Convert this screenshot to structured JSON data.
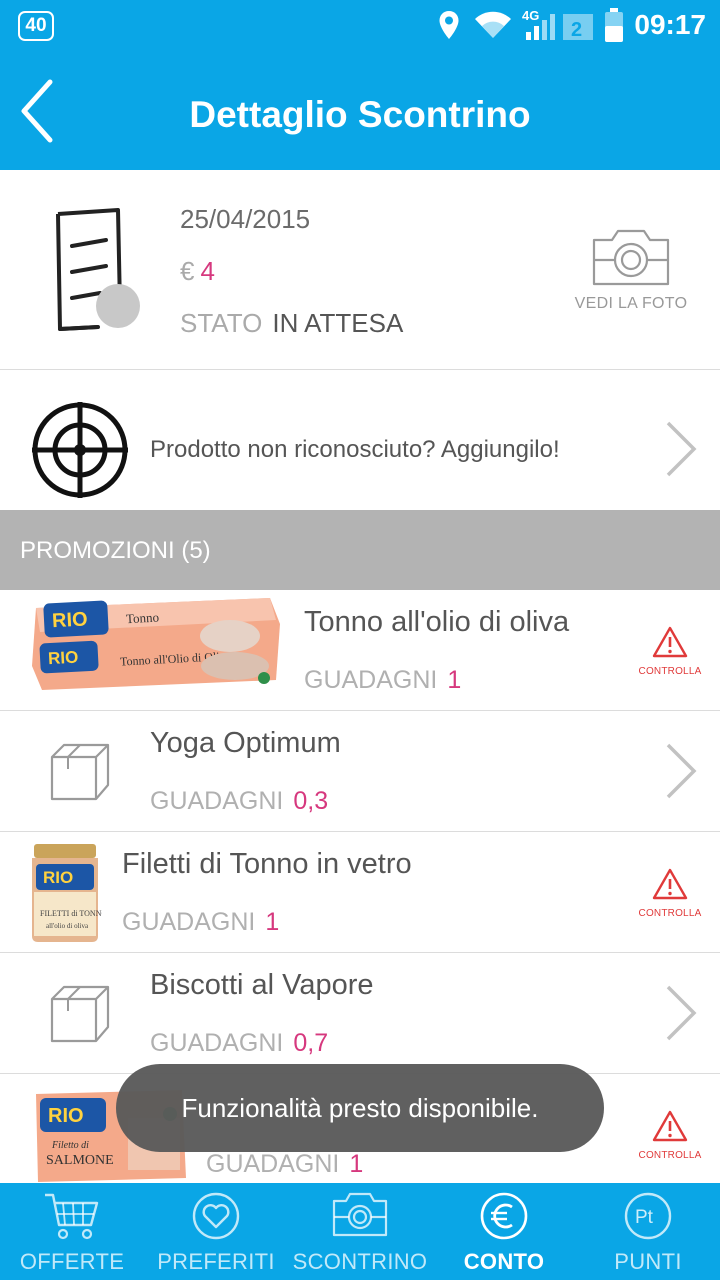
{
  "status_bar": {
    "badge": "40",
    "network": "4G",
    "time": "09:17"
  },
  "header": {
    "title": "Dettaglio Scontrino"
  },
  "receipt": {
    "date": "25/04/2015",
    "currency": "€",
    "amount": "4",
    "state_label": "STATO",
    "state_value": "IN ATTESA",
    "photo_label": "VEDI LA FOTO"
  },
  "add_product": {
    "text": "Prodotto non riconosciuto? Aggiungilo!"
  },
  "promotions": {
    "title": "PROMOZIONI (5)",
    "earn_label": "GUADAGNI",
    "warn_label": "CONTROLLA",
    "items": [
      {
        "name": "Tonno all'olio di oliva",
        "value": "1",
        "action": "controlla",
        "thumb": "rio-mare-tonno-pack"
      },
      {
        "name": "Yoga Optimum",
        "value": "0,3",
        "action": "chevron",
        "thumb": "box-icon"
      },
      {
        "name": "Filetti di Tonno in vetro",
        "value": "1",
        "action": "controlla",
        "thumb": "rio-mare-jar"
      },
      {
        "name": "Biscotti al Vapore",
        "value": "0,7",
        "action": "chevron",
        "thumb": "box-icon"
      },
      {
        "name": "",
        "value": "1",
        "action": "controlla",
        "thumb": "rio-mare-salmone-pack"
      }
    ]
  },
  "toast": {
    "text": "Funzionalità presto disponibile."
  },
  "nav": {
    "active": "conto",
    "items": [
      {
        "id": "offerte",
        "label": "OFFERTE",
        "icon": "cart-icon"
      },
      {
        "id": "preferiti",
        "label": "PREFERITI",
        "icon": "heart-icon"
      },
      {
        "id": "scontrino",
        "label": "SCONTRINO",
        "icon": "camera-icon"
      },
      {
        "id": "conto",
        "label": "CONTO",
        "icon": "euro-icon"
      },
      {
        "id": "punti",
        "label": "PUNTI",
        "icon": "points-icon"
      }
    ]
  },
  "colors": {
    "primary": "#0aa6e6",
    "accent": "#d6387e",
    "warning": "#e03a3a",
    "section": "#b3b3b3"
  }
}
